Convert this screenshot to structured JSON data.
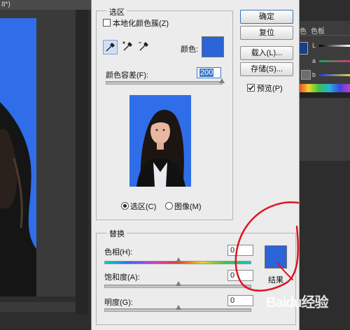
{
  "background": {
    "doc_tab": "8*)",
    "right_panel_tabs": [
      "色",
      "色板"
    ],
    "right_panel_letters": [
      "L",
      "a",
      "b"
    ]
  },
  "dialog": {
    "selection_group": {
      "legend": "选区",
      "localized_clusters": "本地化颜色簇(Z)",
      "color_label": "颜色:",
      "fuzziness_label": "颜色容差(F):",
      "fuzziness_value": "200",
      "radio_selection": "选区(C)",
      "radio_image": "图像(M)"
    },
    "buttons": {
      "ok": "确定",
      "reset": "复位",
      "load": "载入(L)...",
      "save": "存储(S)...",
      "preview": "预览(P)"
    },
    "replace_group": {
      "legend": "替换",
      "hue_label": "色相(H):",
      "hue_value": "0",
      "saturation_label": "饱和度(A):",
      "saturation_value": "0",
      "lightness_label": "明度(G):",
      "lightness_value": "0",
      "result_label": "结果"
    }
  },
  "watermark": "Baidu经验",
  "colors": {
    "selection_swatch": "#2a64d6",
    "result_swatch": "#2a64d6",
    "photo_bg": "#2f6ee8",
    "annotation": "#e0141e"
  }
}
